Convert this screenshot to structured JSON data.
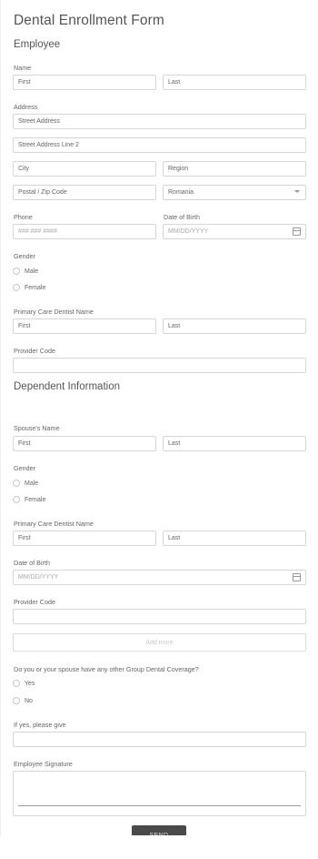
{
  "form": {
    "title": "Dental Enrollment Form",
    "employee_section": "Employee",
    "dependent_section": "Dependent Information",
    "send_label": "SEND",
    "add_more_label": "Add more"
  },
  "employee": {
    "name_label": "Name",
    "first_placeholder": "First",
    "last_placeholder": "Last",
    "address_label": "Address",
    "street1_placeholder": "Street Address",
    "street2_placeholder": "Street Address Line 2",
    "city_placeholder": "City",
    "region_placeholder": "Region",
    "postal_placeholder": "Postal / Zip Code",
    "country_value": "Romania",
    "phone_label": "Phone",
    "phone_placeholder": "### ### ####",
    "dob_label": "Date of Birth",
    "dob_placeholder": "MM/DD/YYYY",
    "gender_label": "Gender",
    "gender_options": [
      "Male",
      "Female"
    ],
    "dentist_label": "Primary Care Dentist Name",
    "provider_label": "Provider Code"
  },
  "dependent": {
    "spouse_label": "Spouse's Name",
    "first_placeholder": "First",
    "last_placeholder": "Last",
    "gender_label": "Gender",
    "gender_options": [
      "Male",
      "Female"
    ],
    "dentist_label": "Primary Care Dentist Name",
    "dob_label": "Date of Birth",
    "dob_placeholder": "MM/DD/YYYY",
    "provider_label": "Provider Code"
  },
  "coverage": {
    "question": "Do you or your spouse have any other Group Dental Coverage?",
    "options": [
      "Yes",
      "No"
    ],
    "ifyes_label": "If yes, please give",
    "signature_label": "Employee Signature"
  }
}
